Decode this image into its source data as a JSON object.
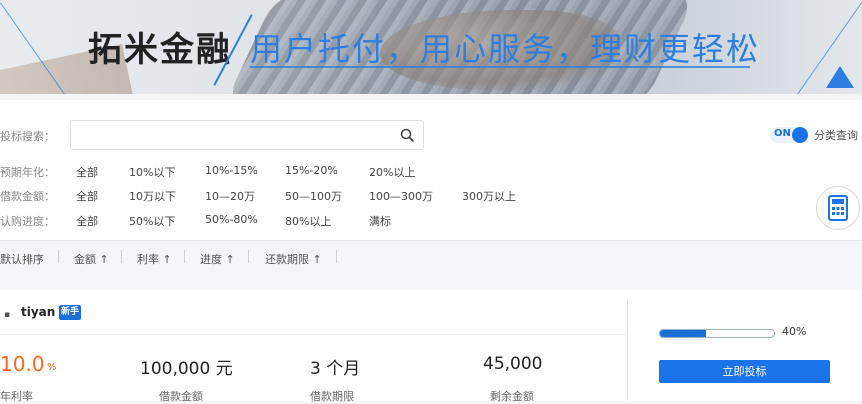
{
  "banner": {
    "logo": "拓米金融",
    "slogan": "用户托付，用心服务，理财更轻松"
  },
  "search": {
    "label": "投标搜索：",
    "placeholder": "",
    "value": ""
  },
  "toggle": {
    "state": "ON",
    "label": "分类查询"
  },
  "filters": [
    {
      "label": "预期年化：",
      "options": [
        "全部",
        "10%以下",
        "10%-15%",
        "15%-20%",
        "20%以上"
      ]
    },
    {
      "label": "借款金额：",
      "options": [
        "全部",
        "10万以下",
        "10—20万",
        "50—100万",
        "100—300万",
        "300万以上"
      ]
    },
    {
      "label": "认购进度：",
      "options": [
        "全部",
        "50%以下",
        "50%-80%",
        "80%以上",
        "满标"
      ]
    }
  ],
  "sort": {
    "default": "默认排序",
    "amount": "金额 ↑",
    "rate": "利率 ↑",
    "progress": "进度 ↑",
    "term": "还款期限 ↑"
  },
  "loan": {
    "user": "tiyan",
    "badge": "新手",
    "rate_value": "10.0",
    "rate_unit": "%",
    "rate_label": "年利率",
    "amount_value": "100,000 元",
    "amount_label": "借款金额",
    "term_value": "3 个月",
    "term_label": "借款期限",
    "remaining_value": "45,000",
    "remaining_label": "剩余金额",
    "progress_percent": 40,
    "progress_text": "40%",
    "invest_button": "立即投标"
  },
  "colors": {
    "accent": "#1a73e8",
    "rate": "#ff6a1f"
  }
}
